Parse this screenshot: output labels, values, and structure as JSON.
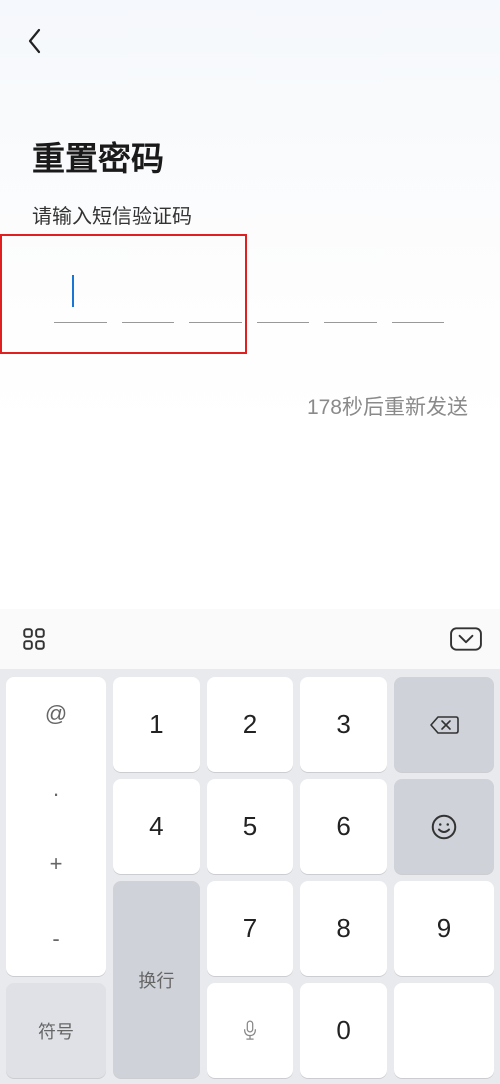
{
  "header": {
    "back_icon": "back"
  },
  "page": {
    "title": "重置密码",
    "subtitle": "请输入短信验证码",
    "resend": "178秒后重新发送"
  },
  "keyboard": {
    "symbols": {
      "at": "@",
      "dot": ".",
      "plus": "+",
      "minus": "-"
    },
    "keys": {
      "k1": "1",
      "k2": "2",
      "k3": "3",
      "k4": "4",
      "k5": "5",
      "k6": "6",
      "k7": "7",
      "k8": "8",
      "k9": "9",
      "k0": "0"
    },
    "symbol_key": "符号",
    "enter": "换行"
  }
}
